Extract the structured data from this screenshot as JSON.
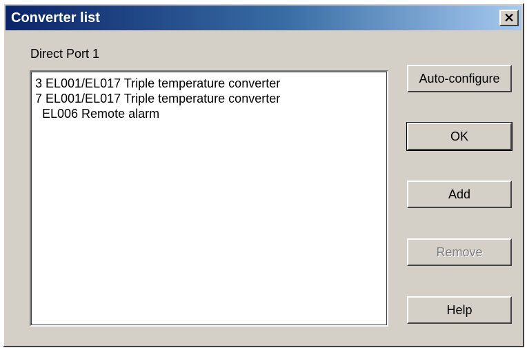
{
  "window": {
    "title": "Converter list",
    "close_symbol": "✕"
  },
  "port_label": "Direct Port 1",
  "converters": [
    "3 EL001/EL017 Triple temperature converter",
    "7 EL001/EL017 Triple temperature converter",
    "  EL006 Remote alarm"
  ],
  "buttons": {
    "auto_configure": "Auto-configure",
    "ok": "OK",
    "add": "Add",
    "remove": "Remove",
    "help": "Help"
  }
}
